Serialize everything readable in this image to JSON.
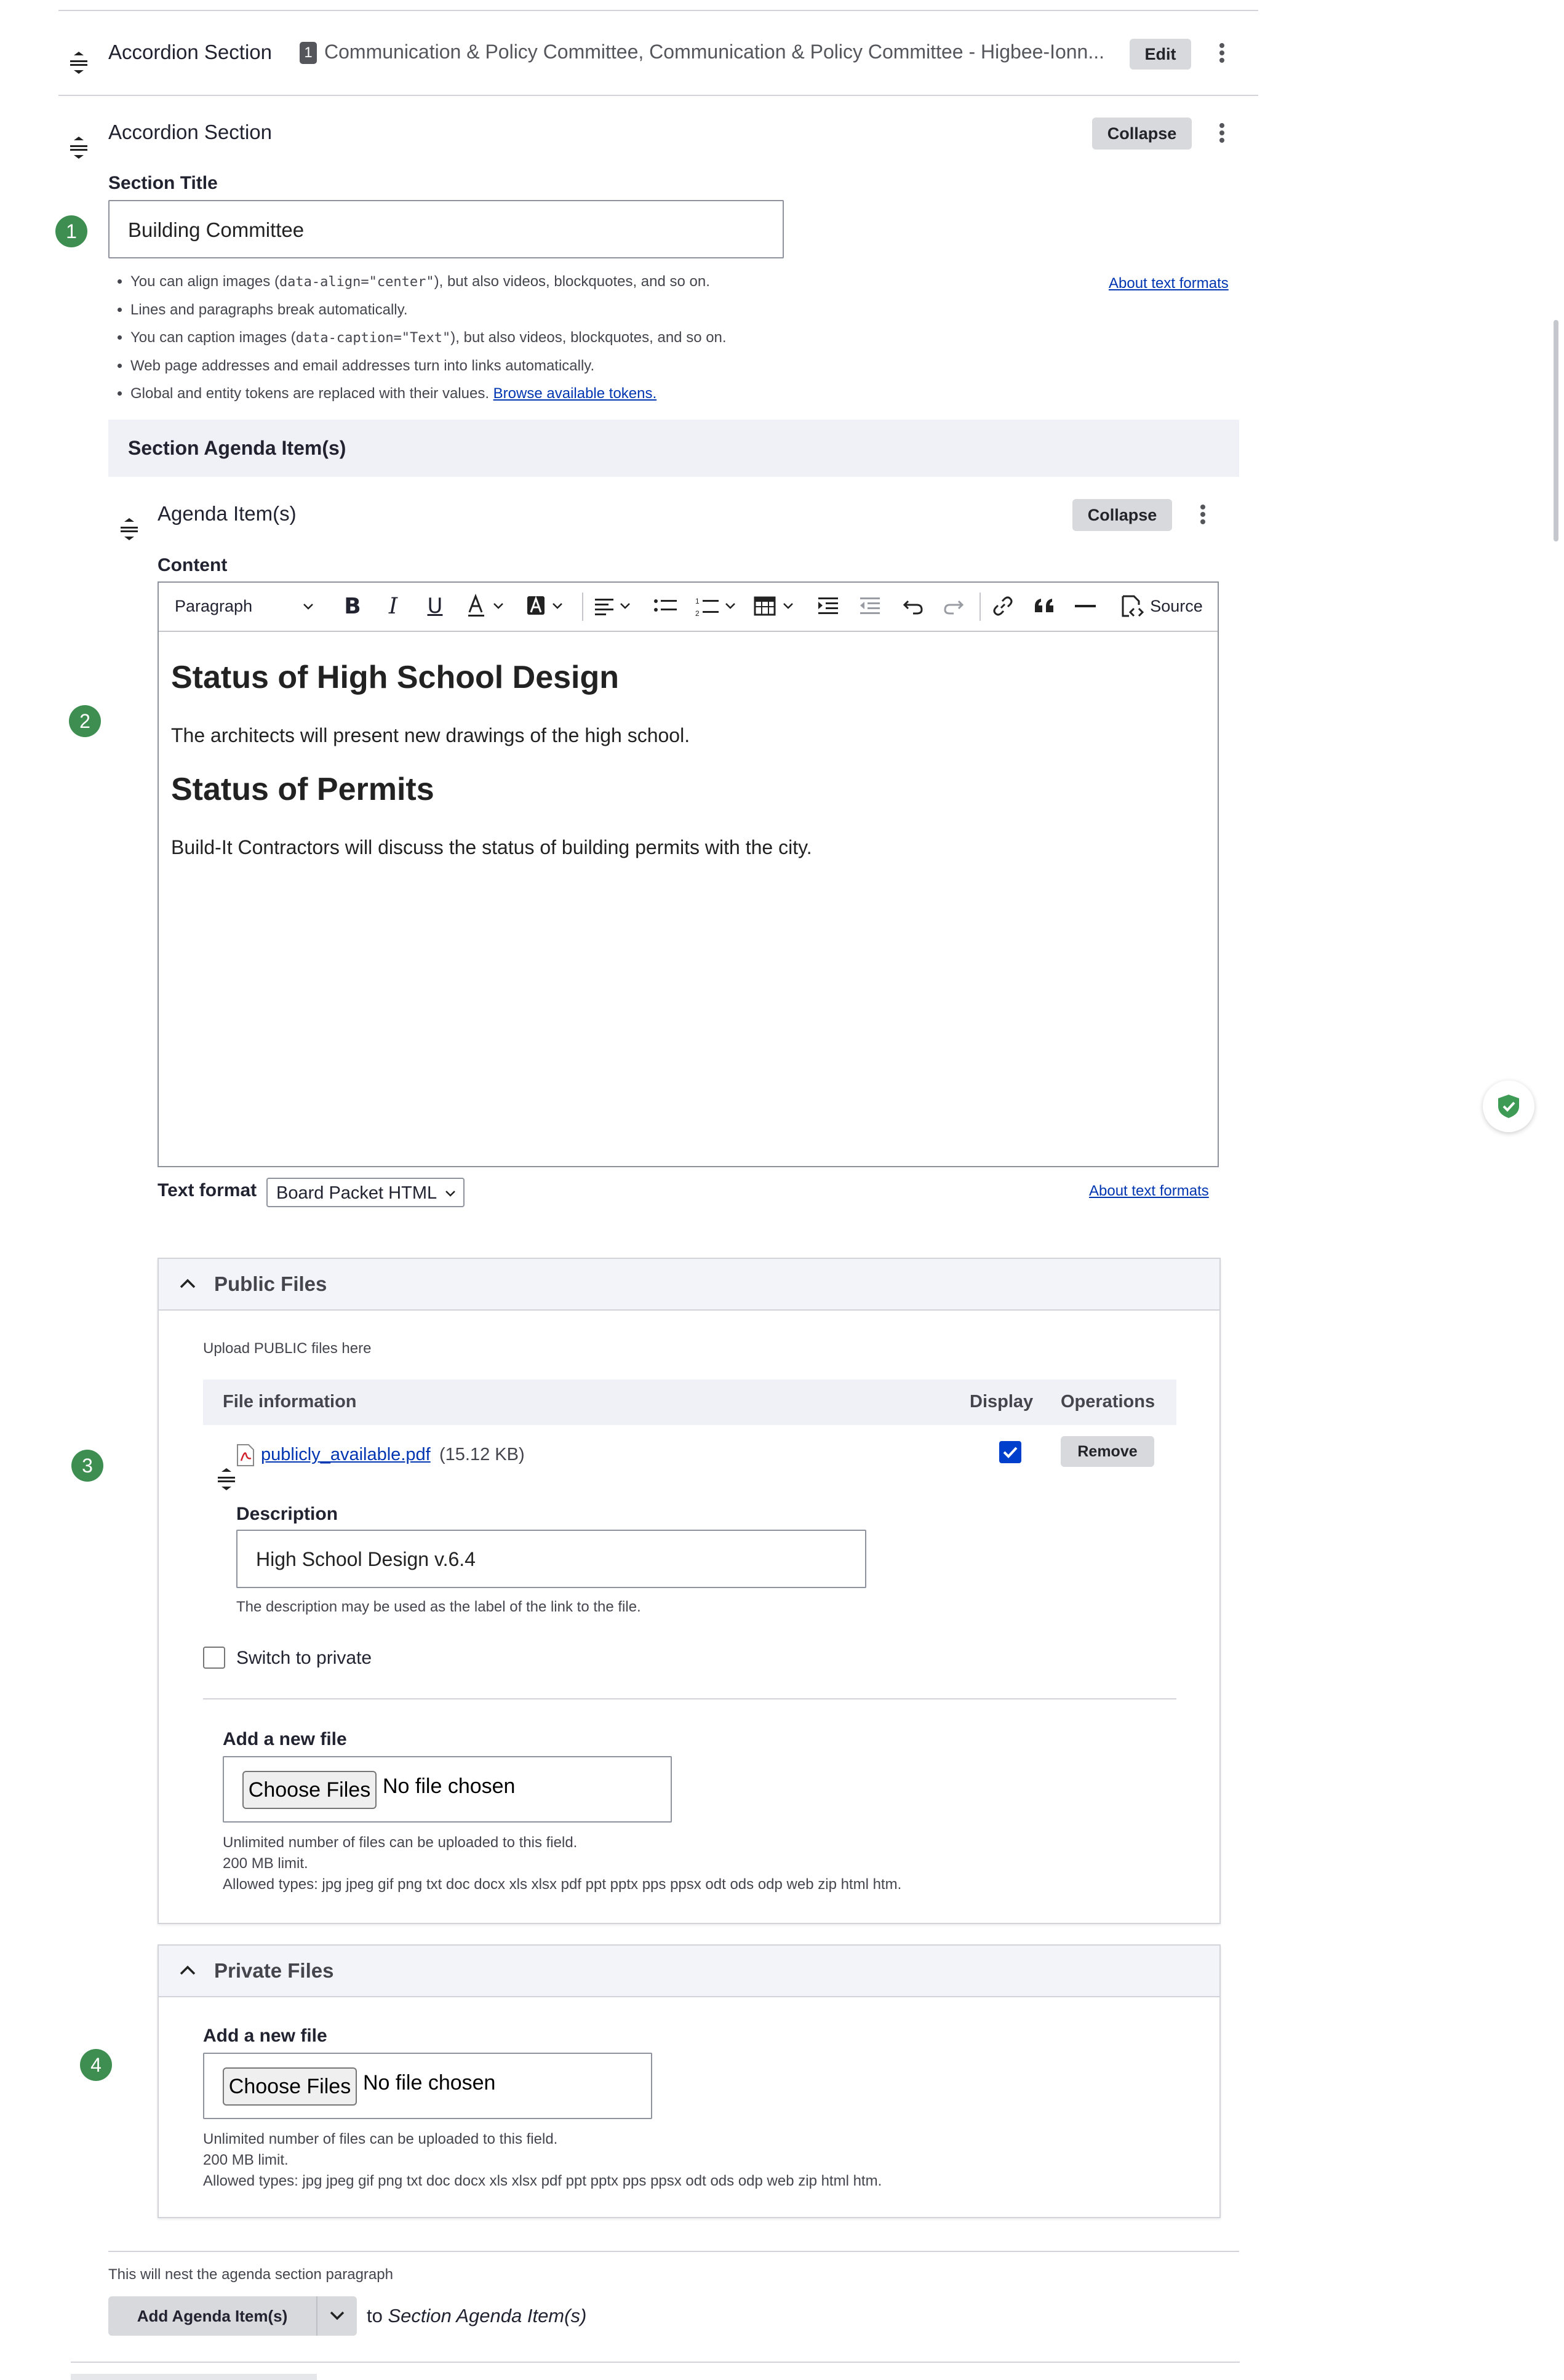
{
  "collapsed_section": {
    "title": "Accordion Section",
    "badge": "1",
    "summary": "Communication & Policy Committee, Communication & Policy Committee - Higbee-Ionn...",
    "edit_label": "Edit"
  },
  "open_section": {
    "title": "Accordion Section",
    "collapse_label": "Collapse",
    "section_title_label": "Section Title",
    "section_title_value": "Building Committee",
    "about_formats": "About text formats",
    "tips": [
      {
        "pre": "You can align images (",
        "code": "data-align=\"center\"",
        "post": "), but also videos, blockquotes, and so on."
      },
      {
        "text": "Lines and paragraphs break automatically."
      },
      {
        "pre": "You can caption images (",
        "code": "data-caption=\"Text\"",
        "post": "), but also videos, blockquotes, and so on."
      },
      {
        "text": "Web page addresses and email addresses turn into links automatically."
      },
      {
        "pre": "Global and entity tokens are replaced with their values. ",
        "link": "Browse available tokens."
      }
    ],
    "agenda_header": "Section Agenda Item(s)"
  },
  "agenda_item": {
    "title": "Agenda Item(s)",
    "collapse_label": "Collapse",
    "content_label": "Content",
    "toolbar": {
      "paragraph": "Paragraph",
      "source": "Source"
    },
    "editor": {
      "h1": "Status of High School Design",
      "p1": "The architects will present new drawings of the high school.",
      "h2": "Status of Permits",
      "p2": "Build-It Contractors will discuss the status of building permits with the city."
    },
    "text_format_label": "Text format",
    "text_format_value": "Board Packet HTML",
    "about_formats": "About text formats"
  },
  "public_files": {
    "title": "Public Files",
    "hint": "Upload PUBLIC files here",
    "columns": {
      "info": "File information",
      "display": "Display",
      "operations": "Operations"
    },
    "file": {
      "name": "publicly_available.pdf",
      "size": "(15.12 KB)",
      "displayed": true,
      "remove_label": "Remove"
    },
    "description_label": "Description",
    "description_value": "High School Design v.6.4",
    "description_help": "The description may be used as the label of the link to the file.",
    "switch_private": "Switch to private",
    "add_file_label": "Add a new file",
    "choose_label": "Choose Files",
    "no_file": "No file chosen",
    "limits": [
      "Unlimited number of files can be uploaded to this field.",
      "200 MB limit.",
      "Allowed types: jpg jpeg gif png txt doc docx xls xlsx pdf ppt pptx pps ppsx odt ods odp web zip html htm."
    ]
  },
  "private_files": {
    "title": "Private Files",
    "add_file_label": "Add a new file",
    "choose_label": "Choose Files",
    "no_file": "No file chosen",
    "limits": [
      "Unlimited number of files can be uploaded to this field.",
      "200 MB limit.",
      "Allowed types: jpg jpeg gif png txt doc docx xls xlsx pdf ppt pptx pps ppsx odt ods odp web zip html htm."
    ]
  },
  "footer": {
    "nest_note": "This will nest the agenda section paragraph",
    "add_button": "Add Agenda Item(s)",
    "to_word": "to",
    "target": "Section Agenda Item(s)"
  },
  "step_markers": [
    "1",
    "2",
    "3",
    "4"
  ],
  "colors": {
    "marker": "#3e8e52",
    "link": "#0036b1",
    "checkbox": "#003ecc"
  },
  "icons": [
    "drag-handle-icon",
    "kebab-menu-icon",
    "bold-icon",
    "italic-icon",
    "underline-icon",
    "font-color-icon",
    "highlight-icon",
    "align-icon",
    "bulleted-list-icon",
    "numbered-list-icon",
    "table-icon",
    "indent-icon",
    "outdent-icon",
    "undo-icon",
    "redo-icon",
    "link-icon",
    "blockquote-icon",
    "horizontal-line-icon",
    "source-icon",
    "chevron-up-icon",
    "pdf-file-icon",
    "shield-check-icon"
  ]
}
